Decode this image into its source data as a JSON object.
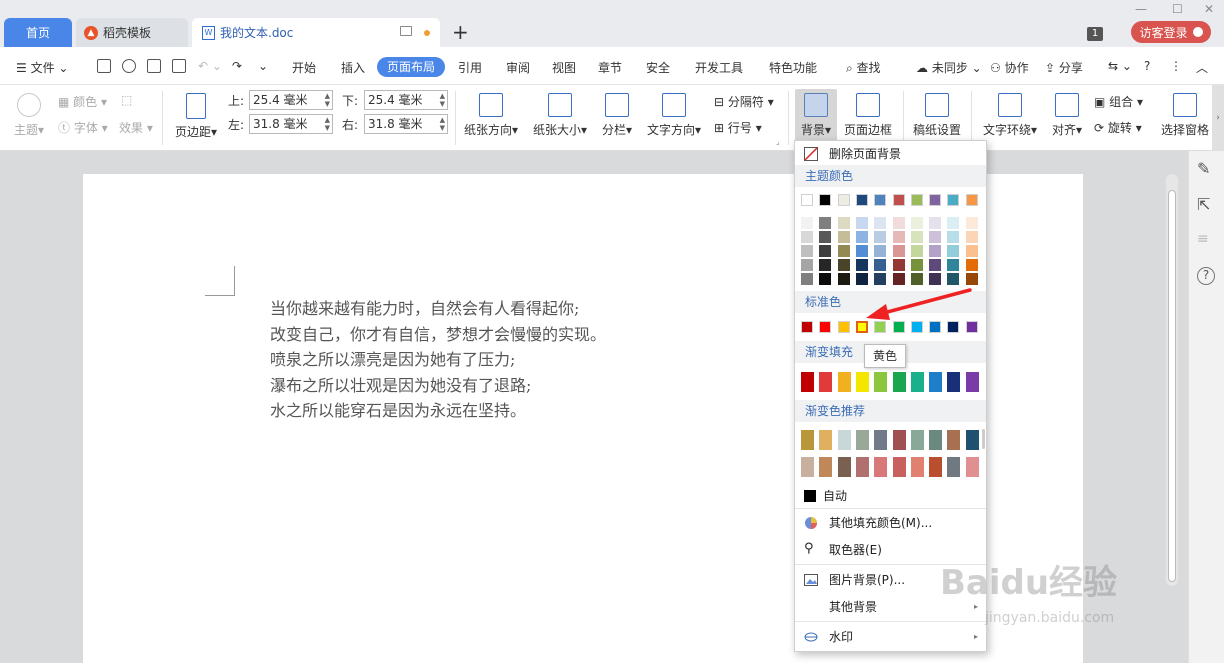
{
  "tabs": {
    "home": "首页",
    "daoke": "稻壳模板",
    "doc": "我的文本.doc",
    "plus": "+"
  },
  "window": {
    "badge": "1",
    "login": "访客登录"
  },
  "menu": {
    "file": "文件",
    "items": [
      "开始",
      "插入",
      "页面布局",
      "引用",
      "审阅",
      "视图",
      "章节",
      "安全",
      "开发工具",
      "特色功能"
    ],
    "active": "页面布局",
    "search": "查找",
    "sync": "未同步",
    "collab": "协作",
    "share": "分享"
  },
  "ribbon": {
    "theme": "主题",
    "color": "颜色",
    "font": "字体",
    "effect": "效果",
    "margins": "页边距",
    "top_label": "上:",
    "top_value": "25.4 毫米",
    "bottom_label": "下:",
    "bottom_value": "25.4 毫米",
    "left_label": "左:",
    "left_value": "31.8 毫米",
    "right_label": "右:",
    "right_value": "31.8 毫米",
    "orientation": "纸张方向",
    "size": "纸张大小",
    "columns": "分栏",
    "text_direction": "文字方向",
    "separator": "分隔符",
    "line_number": "行号",
    "background": "背景",
    "page_border": "页面边框",
    "grid_paper": "稿纸设置",
    "wrap": "文字环绕",
    "align": "对齐",
    "group": "组合",
    "rotate": "旋转",
    "selection_pane": "选择窗格"
  },
  "document": {
    "lines": [
      "当你越来越有能力时，自然会有人看得起你;",
      "改变自己，你才有自信，梦想才会慢慢的实现。",
      "喷泉之所以漂亮是因为她有了压力;",
      "瀑布之所以壮观是因为她没有了退路;",
      "水之所以能穿石是因为永远在坚持。"
    ]
  },
  "dropdown": {
    "delete_bg": "删除页面背景",
    "theme_colors": "主题颜色",
    "standard_colors": "标准色",
    "gradient_fill": "渐变填充",
    "gradient_recommend": "渐变色推荐",
    "auto": "自动",
    "more_fill": "其他填充颜色(M)...",
    "eyedropper": "取色器(E)",
    "picture_bg": "图片背景(P)...",
    "other_bg": "其他背景",
    "watermark": "水印",
    "tooltip": "黄色",
    "theme_row": [
      "#ffffff",
      "#000000",
      "#eeece1",
      "#1f497d",
      "#4f81bd",
      "#c0504d",
      "#9bbb59",
      "#8064a2",
      "#4bacc6",
      "#f79646"
    ],
    "theme_shades": [
      [
        "#f2f2f2",
        "#7f7f7f",
        "#ddd9c3",
        "#c6d9f0",
        "#dbe5f1",
        "#f2dcdb",
        "#ebf1dd",
        "#e5e0ec",
        "#dbeef3",
        "#fdeada"
      ],
      [
        "#d8d8d8",
        "#595959",
        "#c4bd97",
        "#8db3e2",
        "#b8cce4",
        "#e5b9b7",
        "#d7e3bc",
        "#ccc1d9",
        "#b7dde8",
        "#fbd5b5"
      ],
      [
        "#bfbfbf",
        "#3f3f3f",
        "#938953",
        "#548dd4",
        "#95b3d7",
        "#d99694",
        "#c3d69b",
        "#b2a2c7",
        "#92cddc",
        "#fac08f"
      ],
      [
        "#a5a5a5",
        "#262626",
        "#494429",
        "#17365d",
        "#366092",
        "#953734",
        "#76923c",
        "#5f497a",
        "#31859b",
        "#e36c09"
      ],
      [
        "#7f7f7f",
        "#0c0c0c",
        "#1d1b10",
        "#0f243e",
        "#244061",
        "#632423",
        "#4f6128",
        "#3f3151",
        "#205867",
        "#974806"
      ]
    ],
    "standard": [
      "#c00000",
      "#ff0000",
      "#ffc000",
      "#ffff00",
      "#92d050",
      "#00b050",
      "#00b0f0",
      "#0070c0",
      "#002060",
      "#7030a0"
    ],
    "gradient": [
      "#c00000",
      "#e03a3a",
      "#f0b020",
      "#f5e600",
      "#8cc63f",
      "#1aa550",
      "#1ab08a",
      "#1e7fc8",
      "#1a2f7a",
      "#7a3aa8"
    ],
    "recommend_row1": [
      "#b8963a",
      "#e0b060",
      "#c8d8d8",
      "#9aa89a",
      "#707a88",
      "#a05050",
      "#8aa898",
      "#6a8a80",
      "#a87050",
      "#1f5070"
    ],
    "recommend_row2": [
      "#c8b0a0",
      "#c08858",
      "#7a6050",
      "#b07070",
      "#d87878",
      "#c86060",
      "#e08070",
      "#b85030",
      "#707880",
      "#e09090"
    ],
    "auto_color": "#000000"
  },
  "colors": {
    "accent": "#4a86e8",
    "login": "#d9534f",
    "arrow": "#ee2222"
  }
}
